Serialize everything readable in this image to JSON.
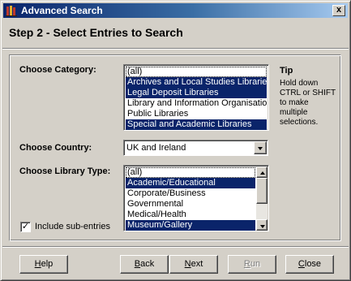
{
  "window": {
    "title": "Advanced Search",
    "close_glyph": "x"
  },
  "step": {
    "heading": "Step 2 - Select Entries to Search"
  },
  "category": {
    "label": "Choose Category:",
    "items": [
      {
        "text": "(all)",
        "selected": false
      },
      {
        "text": "Archives and Local Studies Libraries",
        "selected": true
      },
      {
        "text": "Legal Deposit Libraries",
        "selected": true
      },
      {
        "text": "Library and Information Organisations",
        "selected": false
      },
      {
        "text": "Public Libraries",
        "selected": false
      },
      {
        "text": "Special and Academic Libraries",
        "selected": true
      }
    ]
  },
  "tip": {
    "title": "Tip",
    "text": "Hold down CTRL or SHIFT to make multiple selections."
  },
  "country": {
    "label": "Choose Country:",
    "value": "UK and Ireland"
  },
  "library_type": {
    "label": "Choose Library Type:",
    "items": [
      {
        "text": "(all)",
        "selected": false
      },
      {
        "text": "Academic/Educational",
        "selected": true
      },
      {
        "text": "Corporate/Business",
        "selected": false
      },
      {
        "text": "Governmental",
        "selected": false
      },
      {
        "text": "Medical/Health",
        "selected": false
      },
      {
        "text": "Museum/Gallery",
        "selected": true
      }
    ]
  },
  "include_sub_entries": {
    "label": "Include sub-entries",
    "checked": true,
    "check_glyph": "✓"
  },
  "buttons": {
    "help": {
      "mnemonic": "H",
      "rest": "elp"
    },
    "back": {
      "mnemonic": "B",
      "rest": "ack"
    },
    "next": {
      "mnemonic": "N",
      "rest": "ext"
    },
    "run": {
      "mnemonic": "R",
      "rest": "un"
    },
    "close": {
      "mnemonic": "C",
      "rest": "lose"
    }
  }
}
